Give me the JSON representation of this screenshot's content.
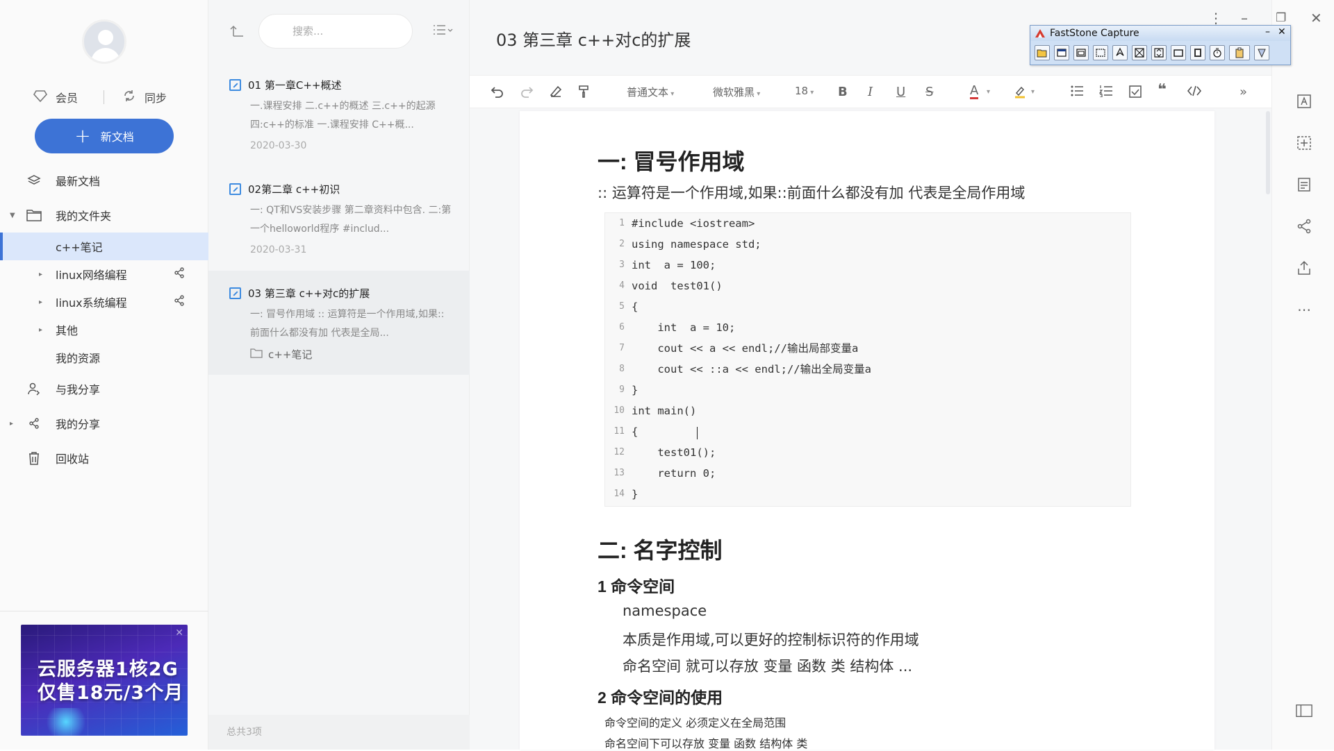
{
  "sidebar": {
    "vip_label": "会员",
    "sync_label": "同步",
    "new_doc_label": "新文档",
    "items": [
      {
        "label": "最新文档"
      },
      {
        "label": "我的文件夹"
      },
      {
        "label": "c++笔记"
      },
      {
        "label": "linux网络编程"
      },
      {
        "label": "linux系统编程"
      },
      {
        "label": "其他"
      },
      {
        "label": "我的资源"
      },
      {
        "label": "与我分享"
      },
      {
        "label": "我的分享"
      },
      {
        "label": "回收站"
      }
    ],
    "ad": {
      "line1": "云服务器1核2G",
      "line2": "仅售18元/3个月"
    }
  },
  "list": {
    "search_placeholder": "搜索...",
    "notes": [
      {
        "title": "01 第一章C++概述",
        "summary": "一.课程安排 二.c++的概述 三.c++的起源 四:c++的标准 一.课程安排 C++概...",
        "date": "2020-03-30"
      },
      {
        "title": "02第二章 c++初识",
        "summary": "一: QT和VS安装步骤 第二章资料中包含. 二:第一个helloworld程序 #includ...",
        "date": "2020-03-31"
      },
      {
        "title": "03 第三章 c++对c的扩展",
        "summary": "一: 冒号作用域 :: 运算符是一个作用域,如果::前面什么都没有加 代表是全局...",
        "folder": "c++笔记"
      }
    ],
    "footer": "总共3项"
  },
  "editor": {
    "title": "03 第三章 c++对c的扩展",
    "toolbar": {
      "style": "普通文本",
      "font": "微软雅黑",
      "size": "18"
    },
    "h1a": "一: 冒号作用域",
    "p1": ":: 运算符是一个作用域,如果::前面什么都没有加 代表是全局作用域",
    "code_lines": [
      "#include <iostream>",
      "using namespace std;",
      "int  a = 100;",
      "void  test01()",
      "{",
      "    int  a = 10;",
      "    cout << a << endl;//输出局部变量a",
      "    cout << ::a << endl;//输出全局变量a",
      "}",
      "int main()",
      "{",
      "    test01();",
      "    return 0;",
      "}"
    ],
    "h1b": "二: 名字控制",
    "h2a": "1  命令空间",
    "li1": "namespace",
    "li2": "本质是作用域,可以更好的控制标识符的作用域",
    "li3": "命名空间 就可以存放 变量  函数  类 结构体 ...",
    "h2b": "2  命令空间的使用",
    "s1": "命令空间的定义 必须定义在全局范围",
    "s2": "命名空间下可以存放 变量 函数 结构体 类"
  },
  "faststone": {
    "title": "FastStone Capture"
  },
  "colors": {
    "accent": "#3d73d6",
    "active_bg": "#dbe7fb"
  }
}
